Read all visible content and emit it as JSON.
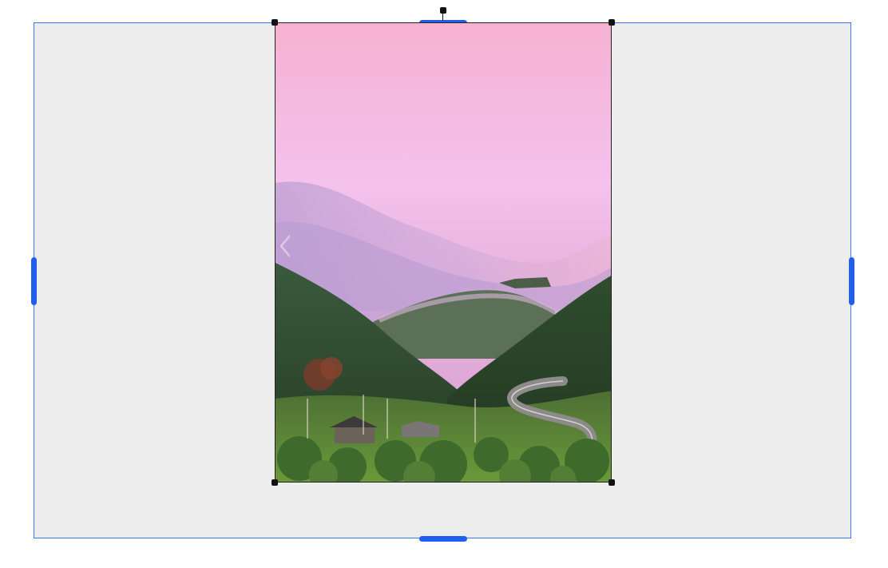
{
  "canvas": {
    "frame_color": "#ededed",
    "selection_color": "#3b78f0",
    "edge_handle_color": "#1f5ff0",
    "corner_handle_color": "#111111"
  },
  "image": {
    "alt": "",
    "sky_top_color": "#f5b4d6",
    "sky_mid_color": "#f2c3ec",
    "mist_color": "#c9a6d6",
    "forest_color": "#2f4a2c",
    "grass_color": "#6f9b3f"
  },
  "icons": {
    "prev": "chevron-left-icon",
    "rotate": "rotate-handle-icon"
  }
}
